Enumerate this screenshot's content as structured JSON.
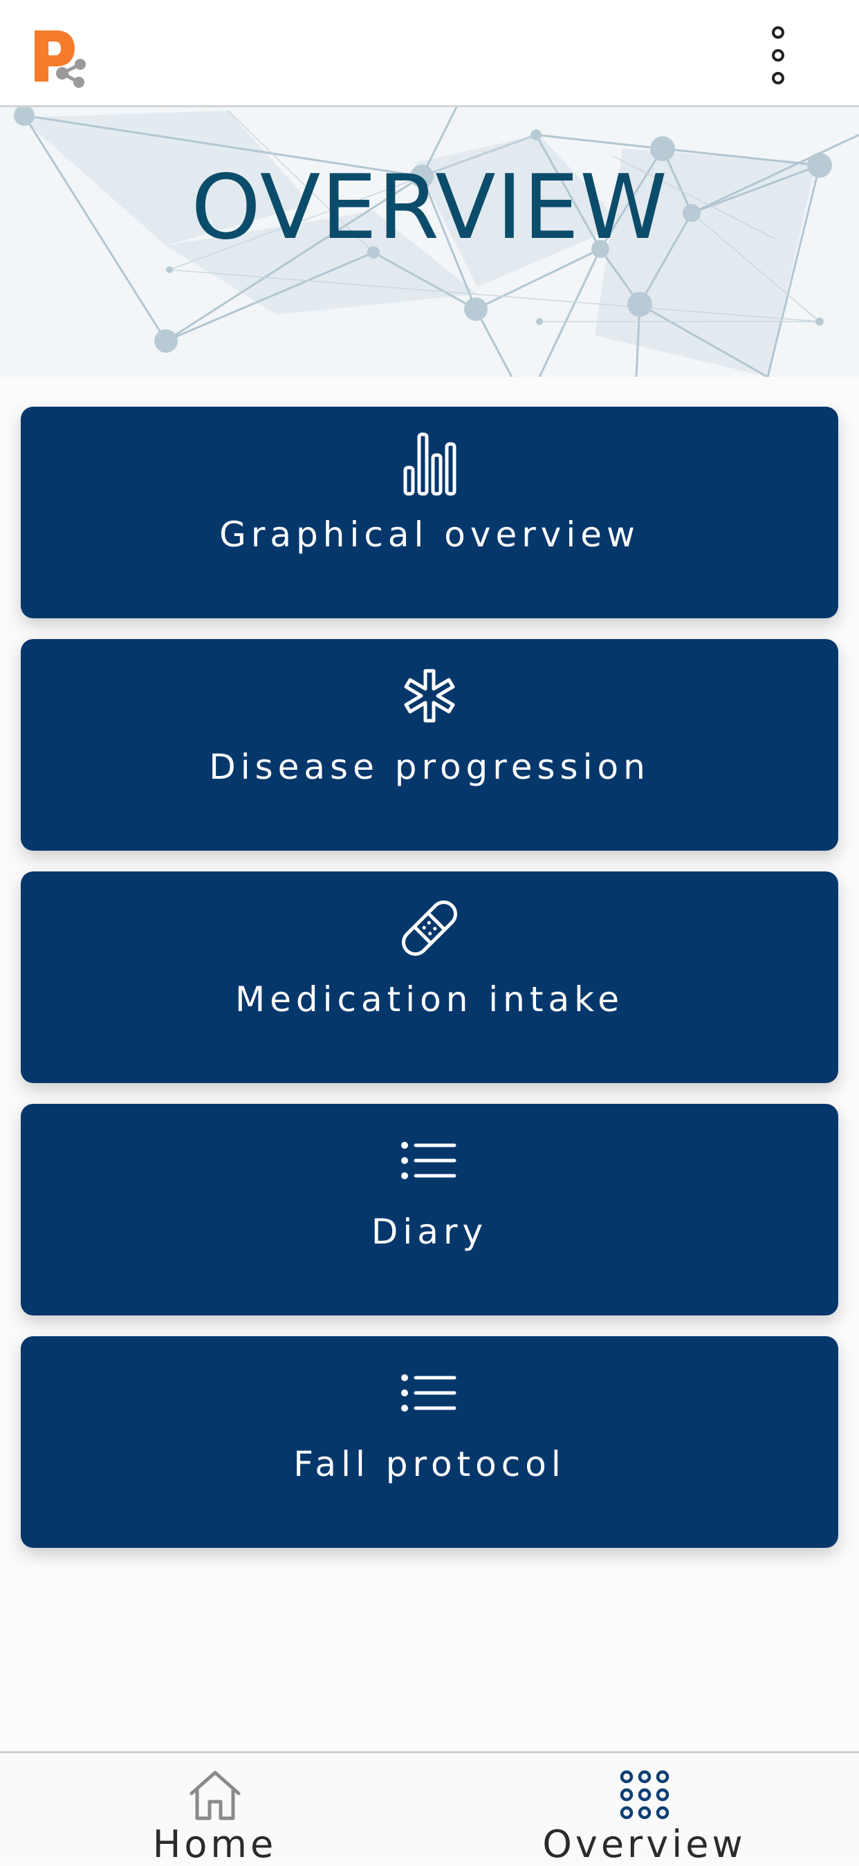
{
  "appbar": {
    "logo_letter": "P",
    "menu_icon": "more-vertical-icon"
  },
  "hero": {
    "title": "OVERVIEW"
  },
  "menu": {
    "items": [
      {
        "label": "Graphical overview",
        "icon": "bar-chart-icon"
      },
      {
        "label": "Disease progression",
        "icon": "asterisk-icon"
      },
      {
        "label": "Medication intake",
        "icon": "bandage-icon"
      },
      {
        "label": "Diary",
        "icon": "list-icon"
      },
      {
        "label": "Fall protocol",
        "icon": "list-icon"
      }
    ]
  },
  "bottom_nav": {
    "items": [
      {
        "label": "Home",
        "icon": "home-icon",
        "active": false
      },
      {
        "label": "Overview",
        "icon": "grid-icon",
        "active": true
      }
    ]
  },
  "colors": {
    "card_background": "#06376b",
    "title_color": "#0b4c6b",
    "logo_orange": "#f47c2c",
    "logo_gray": "#9a9a9a",
    "nav_active": "#0d3f73",
    "nav_inactive": "#8a8a8a"
  }
}
